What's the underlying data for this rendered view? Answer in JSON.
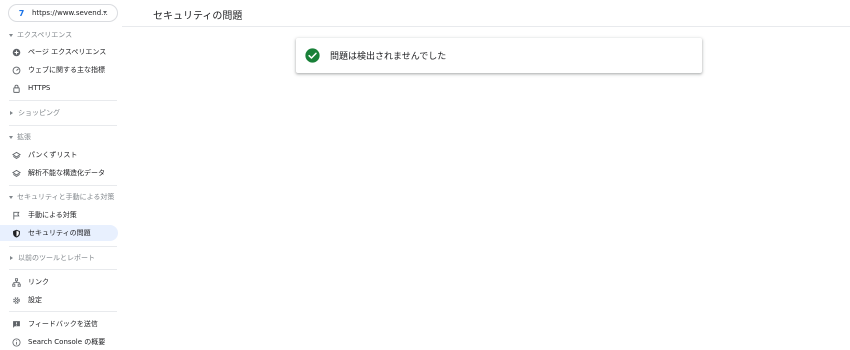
{
  "property": {
    "url": "https://www.sevend...",
    "logo": "7"
  },
  "sidebar": {
    "sections": [
      {
        "header": "エクスペリエンス",
        "expanded": true,
        "items": [
          {
            "label": "ページ エクスペリエンス",
            "icon": "plus-circle-icon"
          },
          {
            "label": "ウェブに関する主な指標",
            "icon": "speed-gauge-icon"
          },
          {
            "label": "HTTPS",
            "icon": "lock-icon"
          }
        ]
      },
      {
        "header": "ショッピング",
        "expanded": false,
        "items": []
      },
      {
        "header": "拡張",
        "expanded": true,
        "items": [
          {
            "label": "パンくずリスト",
            "icon": "layers-icon"
          },
          {
            "label": "解析不能な構造化データ",
            "icon": "layers-icon"
          }
        ]
      },
      {
        "header": "セキュリティと手動による対策",
        "expanded": true,
        "items": [
          {
            "label": "手動による対策",
            "icon": "flag-icon"
          },
          {
            "label": "セキュリティの問題",
            "icon": "shield-icon",
            "active": true
          }
        ]
      },
      {
        "header": "以前のツールとレポート",
        "expanded": false,
        "items": []
      }
    ],
    "bottom_items": [
      {
        "label": "リンク",
        "icon": "links-icon"
      },
      {
        "label": "設定",
        "icon": "gear-icon"
      }
    ],
    "footer_items": [
      {
        "label": "フィードバックを送信",
        "icon": "feedback-icon"
      },
      {
        "label": "Search Console の概要",
        "icon": "info-icon"
      }
    ]
  },
  "main": {
    "title": "セキュリティの問題",
    "result": {
      "status_icon": "check-circle-icon",
      "status_color": "#188038",
      "text": "問題は検出されませんでした"
    }
  },
  "colors": {
    "active_bg": "#e8f0fe",
    "icon": "#5f6368",
    "section_header": "#80868b"
  }
}
